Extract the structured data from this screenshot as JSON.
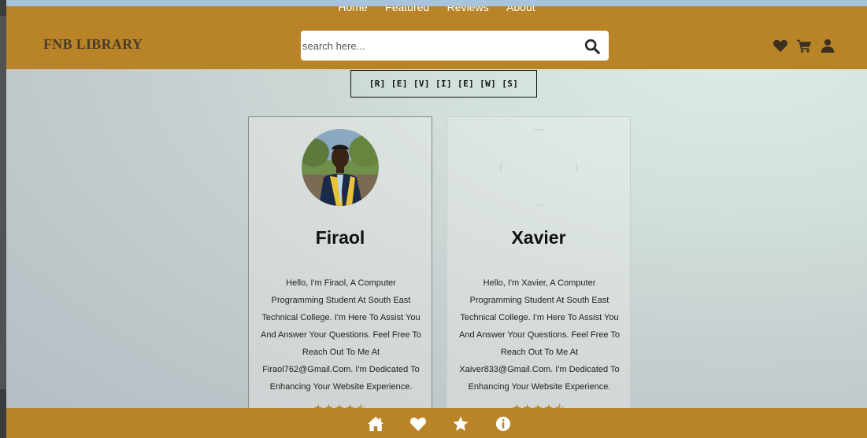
{
  "nav": {
    "links": [
      "Home",
      "Featured",
      "Reviews",
      "About"
    ]
  },
  "header": {
    "logo": "FNB LIBRARY",
    "search_placeholder": "search here...",
    "icons": [
      "heart-icon",
      "cart-icon",
      "user-icon"
    ]
  },
  "reviews": {
    "title": "[R] [E] [V] [I] [E] [W] [S]",
    "cards": [
      {
        "name": "Firaol",
        "text": "Hello, I'm Firaol, A Computer Programming Student At South East Technical College. I'm Here To Assist You And Answer Your Questions. Feel Free To Reach Out To Me At Firaol762@Gmail.Com. I'm Dedicated To Enhancing Your Website Experience.",
        "rating": 4.5
      },
      {
        "name": "Xavier",
        "text": "Hello, I'm Xavier, A Computer Programming Student At South East Technical College. I'm Here To Assist You And Answer Your Questions. Feel Free To Reach Out To Me At Xaiver833@Gmail.Com. I'm Dedicated To Enhancing Your Website Experience.",
        "rating": 4.5
      }
    ]
  },
  "footer": {
    "icons": [
      "home-icon",
      "heart-icon",
      "star-icon",
      "info-icon"
    ]
  },
  "colors": {
    "brand": "#b88427",
    "logo_text": "#4a3a2a",
    "footer_icon": "#ffffff"
  }
}
